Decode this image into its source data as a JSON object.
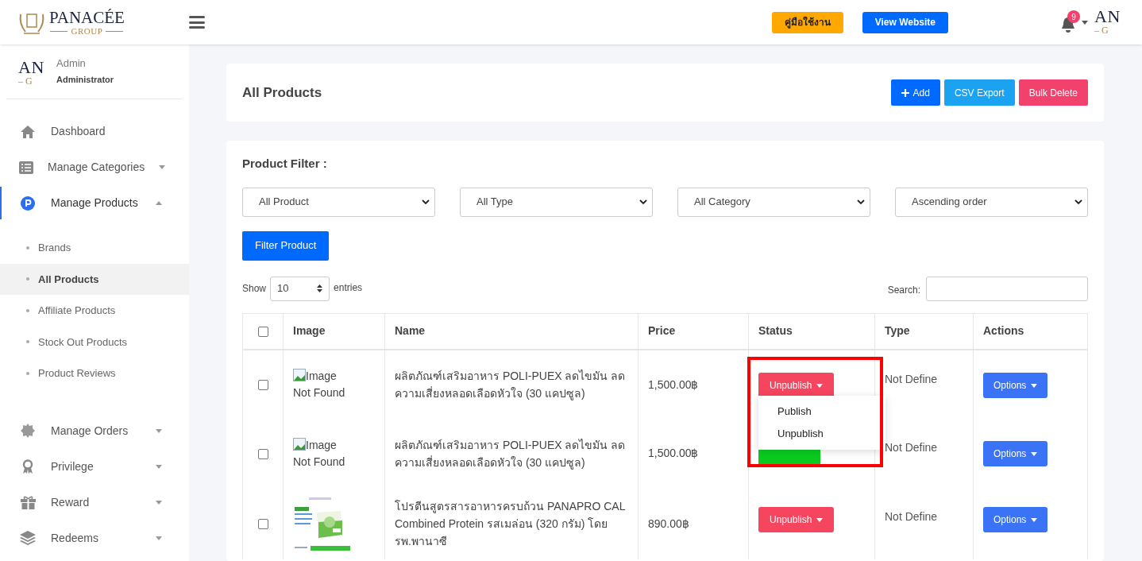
{
  "header": {
    "logo": {
      "top": "PANACÉE",
      "bottom": "GROUP"
    },
    "buttons": [
      {
        "label": "คู่มือใช้งาน",
        "kind": "manual"
      },
      {
        "label": "View Website",
        "kind": "website"
      }
    ],
    "notifications": "9",
    "avatar": {
      "top": "AN",
      "bottom": "– G"
    }
  },
  "user": {
    "avatar": {
      "top": "AN",
      "bottom": "– G"
    },
    "name": "Admin",
    "role": "Administrator"
  },
  "sidebar": {
    "items": [
      {
        "label": "Dashboard",
        "expandable": false,
        "selected": false
      },
      {
        "label": "Manage Categories",
        "expandable": true,
        "expanded": false,
        "selected": false
      },
      {
        "label": "Manage Products",
        "expandable": true,
        "expanded": true,
        "selected": true,
        "children": [
          {
            "label": "Brands",
            "selected": false
          },
          {
            "label": "All Products",
            "selected": true
          },
          {
            "label": "Affiliate Products",
            "selected": false
          },
          {
            "label": "Stock Out Products",
            "selected": false
          },
          {
            "label": "Product Reviews",
            "selected": false
          }
        ]
      },
      {
        "label": "Manage Orders",
        "expandable": true,
        "expanded": false,
        "selected": false
      },
      {
        "label": "Privilege",
        "expandable": true,
        "expanded": false,
        "selected": false
      },
      {
        "label": "Reward",
        "expandable": true,
        "expanded": false,
        "selected": false
      },
      {
        "label": "Redeems",
        "expandable": true,
        "expanded": false,
        "selected": false
      }
    ]
  },
  "page": {
    "title": "All Products",
    "actions": [
      {
        "label": "Add",
        "kind": "add"
      },
      {
        "label": "CSV Export",
        "kind": "export"
      },
      {
        "label": "Bulk Delete",
        "kind": "delete"
      }
    ]
  },
  "filter": {
    "title": "Product Filter :",
    "selects": [
      "All Product",
      "All Type",
      "All Category",
      "Ascending order"
    ],
    "button": "Filter Product"
  },
  "table_controls": {
    "show": "Show",
    "entries_value": "10",
    "entries": "entries",
    "search": "Search:"
  },
  "table": {
    "all_checked": false,
    "columns": [
      "Image",
      "Name",
      "Price",
      "Status",
      "Type",
      "Actions"
    ],
    "rows": [
      {
        "checked": false,
        "image": {
          "kind": "broken",
          "alt": "Image Not Found"
        },
        "name": "ผลิตภัณฑ์เสริมอาหาร POLI-PUEX ลดไขมัน ลดความเสี่ยงหลอดเลือดหัวใจ (30 แคปซูล)",
        "price": "1,500.00฿",
        "status": {
          "kind": "unpublish",
          "label": "Unpublish"
        },
        "type": "Not Define",
        "action": "Options"
      },
      {
        "checked": false,
        "image": {
          "kind": "broken",
          "alt": "Image Not Found"
        },
        "name": "ผลิตภัณฑ์เสริมอาหาร POLI-PUEX ลดไขมัน ลดความเสี่ยงหลอดเลือดหัวใจ (30 แคปซูล)",
        "price": "1,500.00฿",
        "status": {
          "kind": "publish"
        },
        "type": "Not Define",
        "action": "Options"
      },
      {
        "checked": false,
        "name": "โปรตีนสูตรสารอาหารครบถ้วน PANAPRO CAL Combined Protein รสเมล่อน (320 กรัม) โดย รพ.พานาซี",
        "price": "890.00฿",
        "status": {
          "kind": "unpublish",
          "label": "Unpublish"
        },
        "type": "Not Define",
        "action": "Options"
      }
    ]
  },
  "status_menu": {
    "items": [
      "Publish",
      "Unpublish"
    ]
  }
}
